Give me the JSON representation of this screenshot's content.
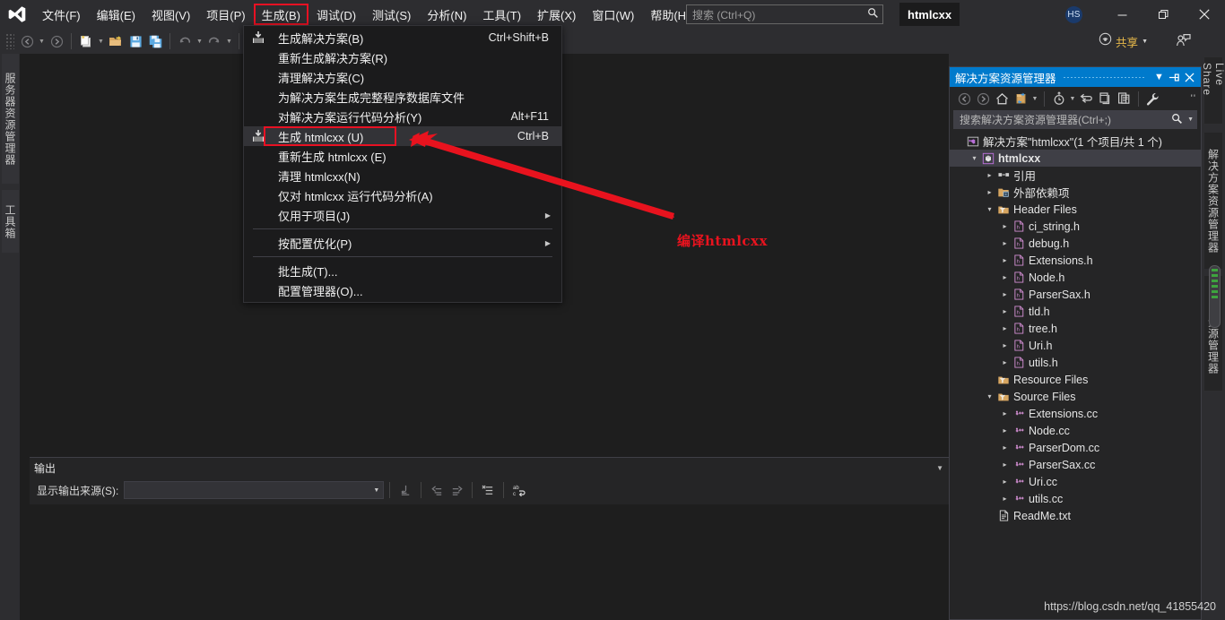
{
  "app": {
    "logo_icon": "visual-studio-logo",
    "project_title": "htmlcxx",
    "avatar_initials": "HS",
    "watermark": "https://blog.csdn.net/qq_41855420"
  },
  "menubar": {
    "items": [
      {
        "label": "文件(F)",
        "name": "menu-file",
        "active": false
      },
      {
        "label": "编辑(E)",
        "name": "menu-edit",
        "active": false
      },
      {
        "label": "视图(V)",
        "name": "menu-view",
        "active": false
      },
      {
        "label": "项目(P)",
        "name": "menu-project",
        "active": false
      },
      {
        "label": "生成(B)",
        "name": "menu-build",
        "active": true
      },
      {
        "label": "调试(D)",
        "name": "menu-debug",
        "active": false
      },
      {
        "label": "测试(S)",
        "name": "menu-test",
        "active": false
      },
      {
        "label": "分析(N)",
        "name": "menu-analyze",
        "active": false
      },
      {
        "label": "工具(T)",
        "name": "menu-tools",
        "active": false
      },
      {
        "label": "扩展(X)",
        "name": "menu-extensions",
        "active": false
      },
      {
        "label": "窗口(W)",
        "name": "menu-window",
        "active": false
      },
      {
        "label": "帮助(H)",
        "name": "menu-help",
        "active": false
      }
    ]
  },
  "quick_search": {
    "placeholder": "搜索 (Ctrl+Q)",
    "icon": "search-icon"
  },
  "window_controls": {
    "minimize": "minimize-icon",
    "restore": "restore-icon",
    "close": "close-icon"
  },
  "toolbar": {
    "share_label": "共享",
    "icons": [
      "navigate-back-icon",
      "navigate-forward-icon",
      "new-project-icon",
      "open-file-icon",
      "save-icon",
      "save-all-icon",
      "undo-icon",
      "redo-icon",
      "build-solution-icon",
      "open-folder-search-icon",
      "filter-icon"
    ],
    "feedback_icon": "send-feedback-icon",
    "broadcast_icon": "live-share-icon"
  },
  "left_tabs": [
    {
      "label": "服务器资源管理器",
      "name": "tab-server-explorer"
    },
    {
      "label": "工具箱",
      "name": "tab-toolbox"
    }
  ],
  "right_tabs": [
    {
      "label": "Live Share",
      "name": "tab-live-share"
    },
    {
      "label": "解决方案资源管理器",
      "name": "tab-solution-explorer"
    },
    {
      "label": "团队资源管理器",
      "name": "tab-team-explorer"
    }
  ],
  "build_menu": {
    "rows": [
      {
        "label": "生成解决方案(B)",
        "shortcut": "Ctrl+Shift+B",
        "icon": "build-solution-icon",
        "highlighted": false,
        "submenu": false,
        "sep_after": false,
        "name": "menuitem-build-solution"
      },
      {
        "label": "重新生成解决方案(R)",
        "shortcut": "",
        "icon": "",
        "highlighted": false,
        "submenu": false,
        "sep_after": false,
        "name": "menuitem-rebuild-solution"
      },
      {
        "label": "清理解决方案(C)",
        "shortcut": "",
        "icon": "",
        "highlighted": false,
        "submenu": false,
        "sep_after": false,
        "name": "menuitem-clean-solution"
      },
      {
        "label": "为解决方案生成完整程序数据库文件",
        "shortcut": "",
        "icon": "",
        "highlighted": false,
        "submenu": false,
        "sep_after": false,
        "name": "menuitem-generate-full-pdb"
      },
      {
        "label": "对解决方案运行代码分析(Y)",
        "shortcut": "Alt+F11",
        "icon": "",
        "highlighted": false,
        "submenu": false,
        "sep_after": false,
        "name": "menuitem-run-code-analysis-solution"
      },
      {
        "label": "生成 htmlcxx (U)",
        "shortcut": "Ctrl+B",
        "icon": "build-project-icon",
        "highlighted": true,
        "submenu": false,
        "sep_after": false,
        "name": "menuitem-build-htmlcxx"
      },
      {
        "label": "重新生成 htmlcxx (E)",
        "shortcut": "",
        "icon": "",
        "highlighted": false,
        "submenu": false,
        "sep_after": false,
        "name": "menuitem-rebuild-htmlcxx"
      },
      {
        "label": "清理 htmlcxx(N)",
        "shortcut": "",
        "icon": "",
        "highlighted": false,
        "submenu": false,
        "sep_after": false,
        "name": "menuitem-clean-htmlcxx"
      },
      {
        "label": "仅对 htmlcxx 运行代码分析(A)",
        "shortcut": "",
        "icon": "",
        "highlighted": false,
        "submenu": false,
        "sep_after": false,
        "name": "menuitem-run-code-analysis-htmlcxx"
      },
      {
        "label": "仅用于项目(J)",
        "shortcut": "",
        "icon": "",
        "highlighted": false,
        "submenu": true,
        "sep_after": true,
        "name": "menuitem-project-only"
      },
      {
        "label": "按配置优化(P)",
        "shortcut": "",
        "icon": "",
        "highlighted": false,
        "submenu": true,
        "sep_after": true,
        "name": "menuitem-profile-guided-optimization"
      },
      {
        "label": "批生成(T)...",
        "shortcut": "",
        "icon": "",
        "highlighted": false,
        "submenu": false,
        "sep_after": false,
        "name": "menuitem-batch-build"
      },
      {
        "label": "配置管理器(O)...",
        "shortcut": "",
        "icon": "",
        "highlighted": false,
        "submenu": false,
        "sep_after": false,
        "name": "menuitem-configuration-manager"
      }
    ]
  },
  "annotation": {
    "text": "编译htmlcxx",
    "color": "#e8131e",
    "arrow": "red-arrow-pointing-to-build-htmlcxx"
  },
  "solution_explorer": {
    "title": "解决方案资源管理器",
    "title_buttons": [
      "chevron-down-icon",
      "pin-icon",
      "close-icon"
    ],
    "toolbar_icons": [
      "back-icon",
      "forward-icon",
      "home-icon",
      "sync-with-active-document-icon",
      "collapse-all-icon",
      "refresh-icon",
      "show-all-files-icon",
      "preview-selected-items-icon",
      "properties-icon"
    ],
    "overflow_icon": "overflow-chevron-icon",
    "search": {
      "placeholder": "搜索解决方案资源管理器(Ctrl+;)",
      "icon": "search-icon",
      "caret": "chevron-down-icon"
    },
    "tree": [
      {
        "label": "解决方案\"htmlcxx\"(1 个项目/共 1 个)",
        "indent": 0,
        "twisty": "",
        "icon": "solution-icon",
        "selected": false,
        "bold": false,
        "name": "tree-solution-root"
      },
      {
        "label": "htmlcxx",
        "indent": 1,
        "twisty": "expanded",
        "icon": "cpp-project-icon",
        "selected": true,
        "bold": true,
        "name": "tree-project-htmlcxx"
      },
      {
        "label": "引用",
        "indent": 2,
        "twisty": "collapsed",
        "icon": "references-icon",
        "selected": false,
        "bold": false,
        "name": "tree-references"
      },
      {
        "label": "外部依赖项",
        "indent": 2,
        "twisty": "collapsed",
        "icon": "folder-icon",
        "selected": false,
        "bold": false,
        "name": "tree-external-dependencies"
      },
      {
        "label": "Header Files",
        "indent": 2,
        "twisty": "expanded",
        "icon": "filter-folder-icon",
        "selected": false,
        "bold": false,
        "name": "tree-header-files"
      },
      {
        "label": "ci_string.h",
        "indent": 3,
        "twisty": "collapsed",
        "icon": "header-file-icon",
        "selected": false,
        "bold": false,
        "name": "tree-file-ci-string-h"
      },
      {
        "label": "debug.h",
        "indent": 3,
        "twisty": "collapsed",
        "icon": "header-file-icon",
        "selected": false,
        "bold": false,
        "name": "tree-file-debug-h"
      },
      {
        "label": "Extensions.h",
        "indent": 3,
        "twisty": "collapsed",
        "icon": "header-file-icon",
        "selected": false,
        "bold": false,
        "name": "tree-file-extensions-h"
      },
      {
        "label": "Node.h",
        "indent": 3,
        "twisty": "collapsed",
        "icon": "header-file-icon",
        "selected": false,
        "bold": false,
        "name": "tree-file-node-h"
      },
      {
        "label": "ParserSax.h",
        "indent": 3,
        "twisty": "collapsed",
        "icon": "header-file-icon",
        "selected": false,
        "bold": false,
        "name": "tree-file-parsersax-h"
      },
      {
        "label": "tld.h",
        "indent": 3,
        "twisty": "collapsed",
        "icon": "header-file-icon",
        "selected": false,
        "bold": false,
        "name": "tree-file-tld-h"
      },
      {
        "label": "tree.h",
        "indent": 3,
        "twisty": "collapsed",
        "icon": "header-file-icon",
        "selected": false,
        "bold": false,
        "name": "tree-file-tree-h"
      },
      {
        "label": "Uri.h",
        "indent": 3,
        "twisty": "collapsed",
        "icon": "header-file-icon",
        "selected": false,
        "bold": false,
        "name": "tree-file-uri-h"
      },
      {
        "label": "utils.h",
        "indent": 3,
        "twisty": "collapsed",
        "icon": "header-file-icon",
        "selected": false,
        "bold": false,
        "name": "tree-file-utils-h"
      },
      {
        "label": "Resource Files",
        "indent": 2,
        "twisty": "",
        "icon": "filter-folder-icon",
        "selected": false,
        "bold": false,
        "name": "tree-resource-files"
      },
      {
        "label": "Source Files",
        "indent": 2,
        "twisty": "expanded",
        "icon": "filter-folder-icon",
        "selected": false,
        "bold": false,
        "name": "tree-source-files"
      },
      {
        "label": "Extensions.cc",
        "indent": 3,
        "twisty": "collapsed",
        "icon": "cpp-file-icon",
        "selected": false,
        "bold": false,
        "name": "tree-file-extensions-cc"
      },
      {
        "label": "Node.cc",
        "indent": 3,
        "twisty": "collapsed",
        "icon": "cpp-file-icon",
        "selected": false,
        "bold": false,
        "name": "tree-file-node-cc"
      },
      {
        "label": "ParserDom.cc",
        "indent": 3,
        "twisty": "collapsed",
        "icon": "cpp-file-icon",
        "selected": false,
        "bold": false,
        "name": "tree-file-parserdom-cc"
      },
      {
        "label": "ParserSax.cc",
        "indent": 3,
        "twisty": "collapsed",
        "icon": "cpp-file-icon",
        "selected": false,
        "bold": false,
        "name": "tree-file-parsersax-cc"
      },
      {
        "label": "Uri.cc",
        "indent": 3,
        "twisty": "collapsed",
        "icon": "cpp-file-icon",
        "selected": false,
        "bold": false,
        "name": "tree-file-uri-cc"
      },
      {
        "label": "utils.cc",
        "indent": 3,
        "twisty": "collapsed",
        "icon": "cpp-file-icon",
        "selected": false,
        "bold": false,
        "name": "tree-file-utils-cc"
      },
      {
        "label": "ReadMe.txt",
        "indent": 2,
        "twisty": "",
        "icon": "text-file-icon",
        "selected": false,
        "bold": false,
        "name": "tree-file-readme-txt"
      }
    ]
  },
  "output_panel": {
    "title": "输出",
    "source_label": "显示输出来源(S):",
    "source_value": "",
    "toolbar_icons": [
      "jump-to-message-icon",
      "previous-message-icon",
      "next-message-icon",
      "clear-all-icon",
      "toggle-word-wrap-icon"
    ],
    "collapse_icon": "chevron-down-icon"
  },
  "colors": {
    "accent": "#007acc",
    "annotation_red": "#e8131e",
    "menu_bg": "#1b1b1c",
    "panel_bg": "#252526",
    "workspace_bg": "#1e1e1e",
    "chrome_bg": "#2d2d30",
    "header_file": "#d48fd4",
    "cpp_file": "#d48fd4",
    "folder": "#d6a560"
  }
}
